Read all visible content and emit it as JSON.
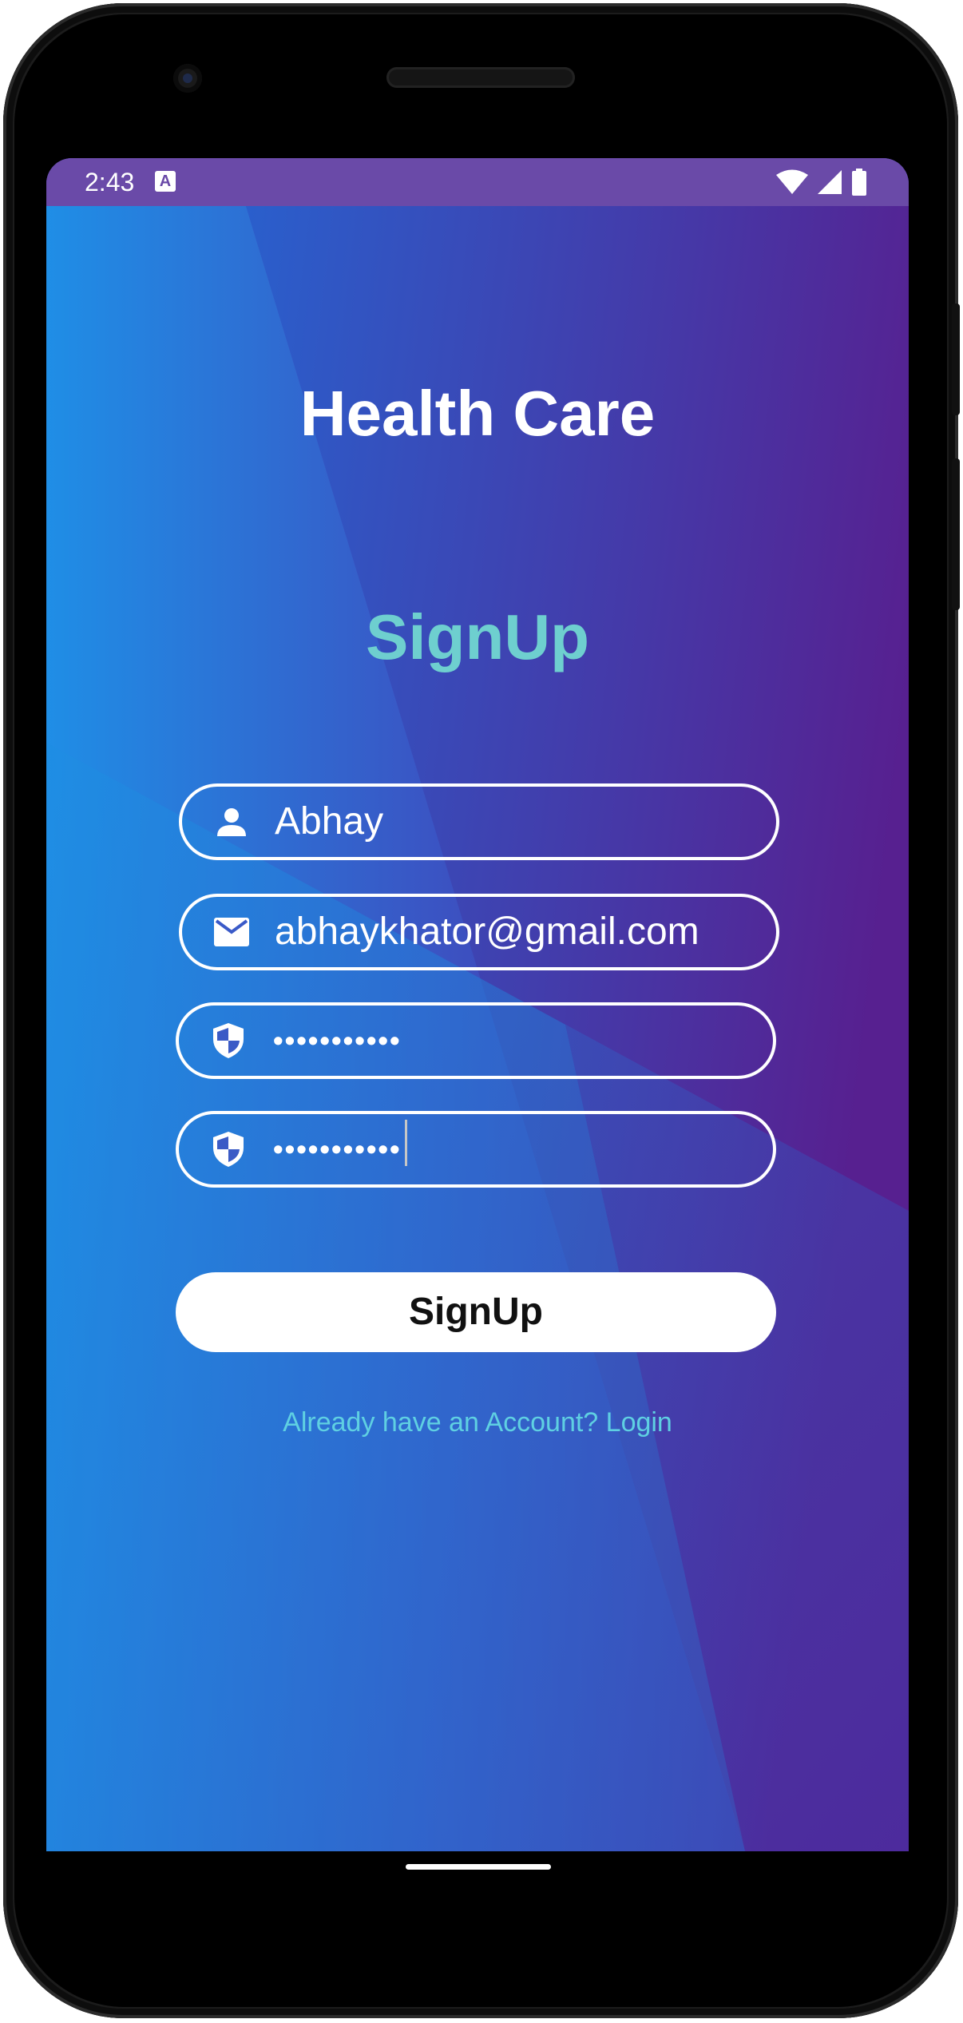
{
  "status_bar": {
    "time": "2:43",
    "notification_icon": "A",
    "icons": [
      "wifi-icon",
      "signal-icon",
      "battery-icon"
    ]
  },
  "app": {
    "title": "Health Care",
    "subtitle": "SignUp"
  },
  "form": {
    "username": {
      "icon": "person-icon",
      "value": "Abhay"
    },
    "email": {
      "icon": "mail-icon",
      "value": "abhaykhator@gmail.com"
    },
    "password": {
      "icon": "shield-icon",
      "value": "•••••••••••"
    },
    "confirm_password": {
      "icon": "shield-icon",
      "value": "•••••••••••"
    }
  },
  "actions": {
    "signup_label": "SignUp",
    "login_link": "Already have an Account? Login"
  },
  "colors": {
    "status_bar": "#6a4aa8",
    "gradient_start": "#1e8fe6",
    "gradient_end": "#5a1f96",
    "subtitle": "#6ecfcf",
    "link": "#5fd0e2",
    "button_bg": "#ffffff"
  }
}
